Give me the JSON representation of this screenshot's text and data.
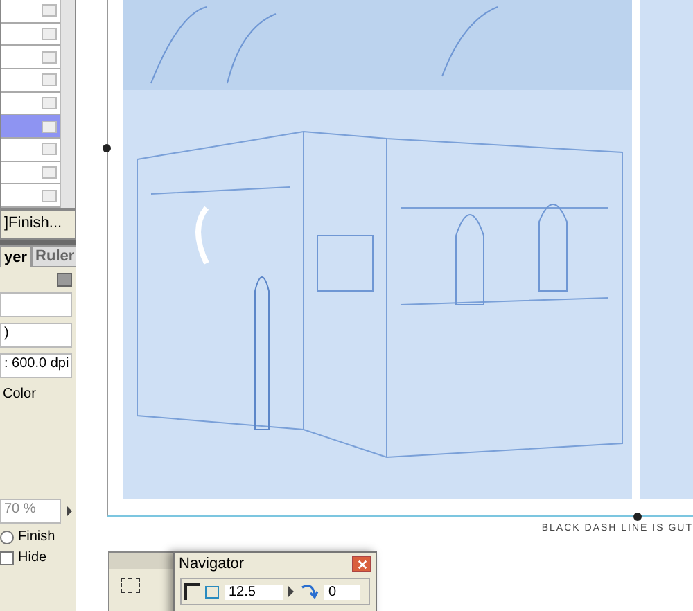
{
  "layer_list": {
    "rows": [
      {
        "selected": false
      },
      {
        "selected": false
      },
      {
        "selected": false
      },
      {
        "selected": false
      },
      {
        "selected": false
      },
      {
        "selected": true
      },
      {
        "selected": false
      },
      {
        "selected": false
      },
      {
        "selected": false
      }
    ],
    "status": "]Finish..."
  },
  "properties": {
    "tabs": [
      {
        "label": "yer",
        "selected": true
      },
      {
        "label": "Ruler",
        "selected": false
      }
    ],
    "fields": [
      {
        "kind": "blank"
      },
      {
        "kind": "field",
        "value": ")"
      },
      {
        "kind": "field",
        "value": ": 600.0 dpi"
      },
      {
        "kind": "text",
        "value": "Color"
      }
    ],
    "opacity": "70 %",
    "options": [
      {
        "kind": "radio",
        "label": "Finish",
        "checked": false
      },
      {
        "kind": "checkbox",
        "label": "Hide",
        "checked": false
      }
    ]
  },
  "canvas": {
    "note": "BLACK DASH LINE IS GUT"
  },
  "navigator": {
    "title": "Navigator",
    "zoom": "12.5",
    "rotation": "0"
  }
}
